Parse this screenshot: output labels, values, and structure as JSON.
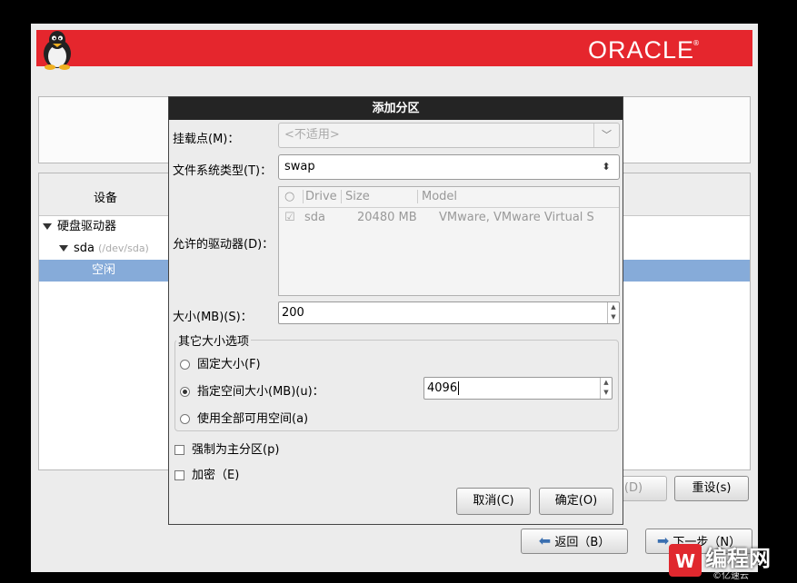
{
  "brand": {
    "name": "ORACLE",
    "mark": "®"
  },
  "tree": {
    "header": "设备",
    "items": [
      {
        "label": "硬盘驱动器"
      },
      {
        "label": "sda",
        "sub": "(/dev/sda)"
      },
      {
        "label": "空闲"
      }
    ]
  },
  "main_buttons": {
    "disabled_label": "(D)",
    "reset": "重设(s)",
    "back": "返回（B）",
    "next": "下一步（N）"
  },
  "dialog": {
    "title": "添加分区",
    "mount_label": "挂载点(M)：",
    "mount_value": "<不适用>",
    "fstype_label": "文件系统类型(T)：",
    "fstype_value": "swap",
    "drives_label": "允许的驱动器(D)：",
    "drives_columns": [
      "Drive",
      "Size",
      "Model"
    ],
    "drives_rows": [
      {
        "drive": "sda",
        "size": "20480 MB",
        "model": "VMware, VMware Virtual S",
        "checked": true
      }
    ],
    "size_label": "大小(MB)(S)：",
    "size_value": "200",
    "other_group": "其它大小选项",
    "opt_fixed": "固定大小(F)",
    "opt_upto": "指定空间大小(MB)(u)：",
    "upto_value": "4096",
    "opt_fill": "使用全部可用空间(a)",
    "force_primary": "强制为主分区(p)",
    "encrypt": "加密（E)",
    "cancel": "取消(C)",
    "ok": "确定(O)"
  },
  "watermark": {
    "text": "编程网",
    "sub": "©亿速云"
  },
  "colors": {
    "banner": "#e5262d",
    "selection": "#86abd9",
    "dialog_title": "#242424"
  }
}
